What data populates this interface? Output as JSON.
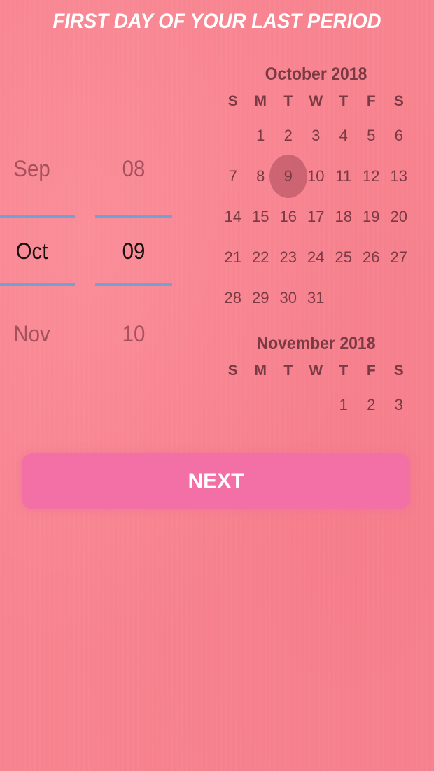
{
  "header": {
    "title": "FIRST DAY OF YOUR LAST PERIOD"
  },
  "picker": {
    "month": {
      "prev": "Sep",
      "current": "Oct",
      "next": "Nov"
    },
    "day": {
      "prev": "08",
      "current": "09",
      "next": "10"
    }
  },
  "calendars": [
    {
      "title": "October 2018",
      "weekdays": [
        "S",
        "M",
        "T",
        "W",
        "T",
        "F",
        "S"
      ],
      "weeks": [
        [
          "",
          "1",
          "2",
          "3",
          "4",
          "5",
          "6"
        ],
        [
          "7",
          "8",
          "9",
          "10",
          "11",
          "12",
          "13"
        ],
        [
          "14",
          "15",
          "16",
          "17",
          "18",
          "19",
          "20"
        ],
        [
          "21",
          "22",
          "23",
          "24",
          "25",
          "26",
          "27"
        ],
        [
          "28",
          "29",
          "30",
          "31",
          "",
          "",
          ""
        ]
      ],
      "selected_day": "9"
    },
    {
      "title": "November 2018",
      "weekdays": [
        "S",
        "M",
        "T",
        "W",
        "T",
        "F",
        "S"
      ],
      "weeks": [
        [
          "",
          "",
          "",
          "",
          "1",
          "2",
          "3"
        ]
      ]
    }
  ],
  "actions": {
    "next_label": "NEXT"
  },
  "colors": {
    "background": "#f7838f",
    "button": "#f270a6",
    "picker_line": "#6fa3d6",
    "calendar_text": "#7a3a44"
  }
}
